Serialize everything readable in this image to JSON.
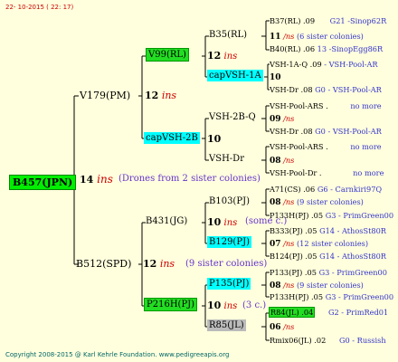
{
  "header": {
    "date": "22- 10-2015 ( 22: 17)"
  },
  "footer": {
    "copyright": "Copyright 2008-2015 @ Karl Kehrle Foundation.   www.pedigreeapis.org"
  },
  "root": {
    "name": "B457(JPN)",
    "gen": "14",
    "ins": "ins",
    "note": "(Drones from 2 sister colonies)"
  },
  "gen1": {
    "sire": {
      "name": "V179(PM)",
      "gen": "12",
      "ins": "ins"
    },
    "dam": {
      "name": "B512(SPD)",
      "gen": "12",
      "ins": "ins",
      "note": "(9 sister colonies)"
    }
  },
  "gen2": {
    "v99": {
      "name": "V99(RL)",
      "gen": "12",
      "ins": "ins"
    },
    "capvsh2b": {
      "name": "capVSH-2B",
      "gen": "10"
    },
    "b431": {
      "name": "B431(JG)",
      "gen": "10",
      "ins": "ins",
      "note": "(some c.)"
    },
    "p216h": {
      "name": "P216H(PJ)",
      "gen": "10",
      "ins": "ins",
      "note": "(3 c.)"
    }
  },
  "gen3": {
    "b35": {
      "name": "B35(RL)",
      "gen": "12",
      "ins": "ins"
    },
    "capvsh1a": {
      "name": "capVSH-1A",
      "gen": "10"
    },
    "vsh2bq": {
      "name": "VSH-2B-Q",
      "gen": "09",
      "ins": "/ns"
    },
    "vshdr": {
      "name": "VSH-Dr",
      "gen": "08",
      "ins": "/ns"
    },
    "b103": {
      "name": "B103(PJ)",
      "gen": "08",
      "ins": "/ns",
      "note": "(9 sister colonies)"
    },
    "b129": {
      "name": "B129(PJ)",
      "gen": "07",
      "ins": "/ns",
      "note": "(12 sister colonies)"
    },
    "p135": {
      "name": "P135(PJ)",
      "gen": "08",
      "ins": "/ns",
      "note": "(9 sister colonies)"
    },
    "r85": {
      "name": "R85(JL)",
      "gen": "06",
      "ins": "/ns"
    }
  },
  "gen4": {
    "r1a": {
      "left": "B37(RL) .09",
      "right": "G21 -Sinop62R"
    },
    "r1b": {
      "gen": "11",
      "ins": "/ns",
      "note": "(6 sister colonies)"
    },
    "r1c": {
      "left": "B40(RL) .06",
      "right": "13 -SinopEgg86R"
    },
    "r2a": {
      "left": "VSH-1A-Q .09",
      "right": "- VSH-Pool-AR"
    },
    "r2c": {
      "left": "VSH-Dr .08",
      "right": "G0 - VSH-Pool-AR"
    },
    "r3a": {
      "left": "VSH-Pool-ARS .",
      "right": "no more"
    },
    "r3c": {
      "left": "VSH-Dr .08",
      "right": "G0 - VSH-Pool-AR"
    },
    "r4a": {
      "left": "VSH-Pool-ARS .",
      "right": "no more"
    },
    "r4c": {
      "left": "VSH-Pool-Dr .",
      "right": "no more"
    },
    "r5a": {
      "left": "A71(CS) .06",
      "right": "G6 - Carnkiri97Q"
    },
    "r5c": {
      "left": "P133H(PJ) .05",
      "right": "G3 - PrimGreen00"
    },
    "r6a": {
      "left": "B333(PJ) .05",
      "right": "G14 - AthosSt80R"
    },
    "r6c": {
      "left": "B124(PJ) .05",
      "right": "G14 - AthosSt80R"
    },
    "r7a": {
      "left": "P133(PJ) .05",
      "right": "G3 - PrimGreen00"
    },
    "r7c": {
      "left": "P133H(PJ) .05",
      "right": "G3 - PrimGreen00"
    },
    "r8a": {
      "left": "R84(JL) .04",
      "right": "G2 - PrimRed01"
    },
    "r8c": {
      "left": "Rmix06(JL) .02",
      "right": "G0 - Russish"
    }
  },
  "colors": {
    "background": "#ffffdd",
    "ins": "#cc0000",
    "note": "#6633cc",
    "green_box": "#22dd22",
    "cyan_box": "#00ffff",
    "gray_box": "#bbbbbb",
    "footer": "#006666",
    "header": "#cc0000"
  }
}
